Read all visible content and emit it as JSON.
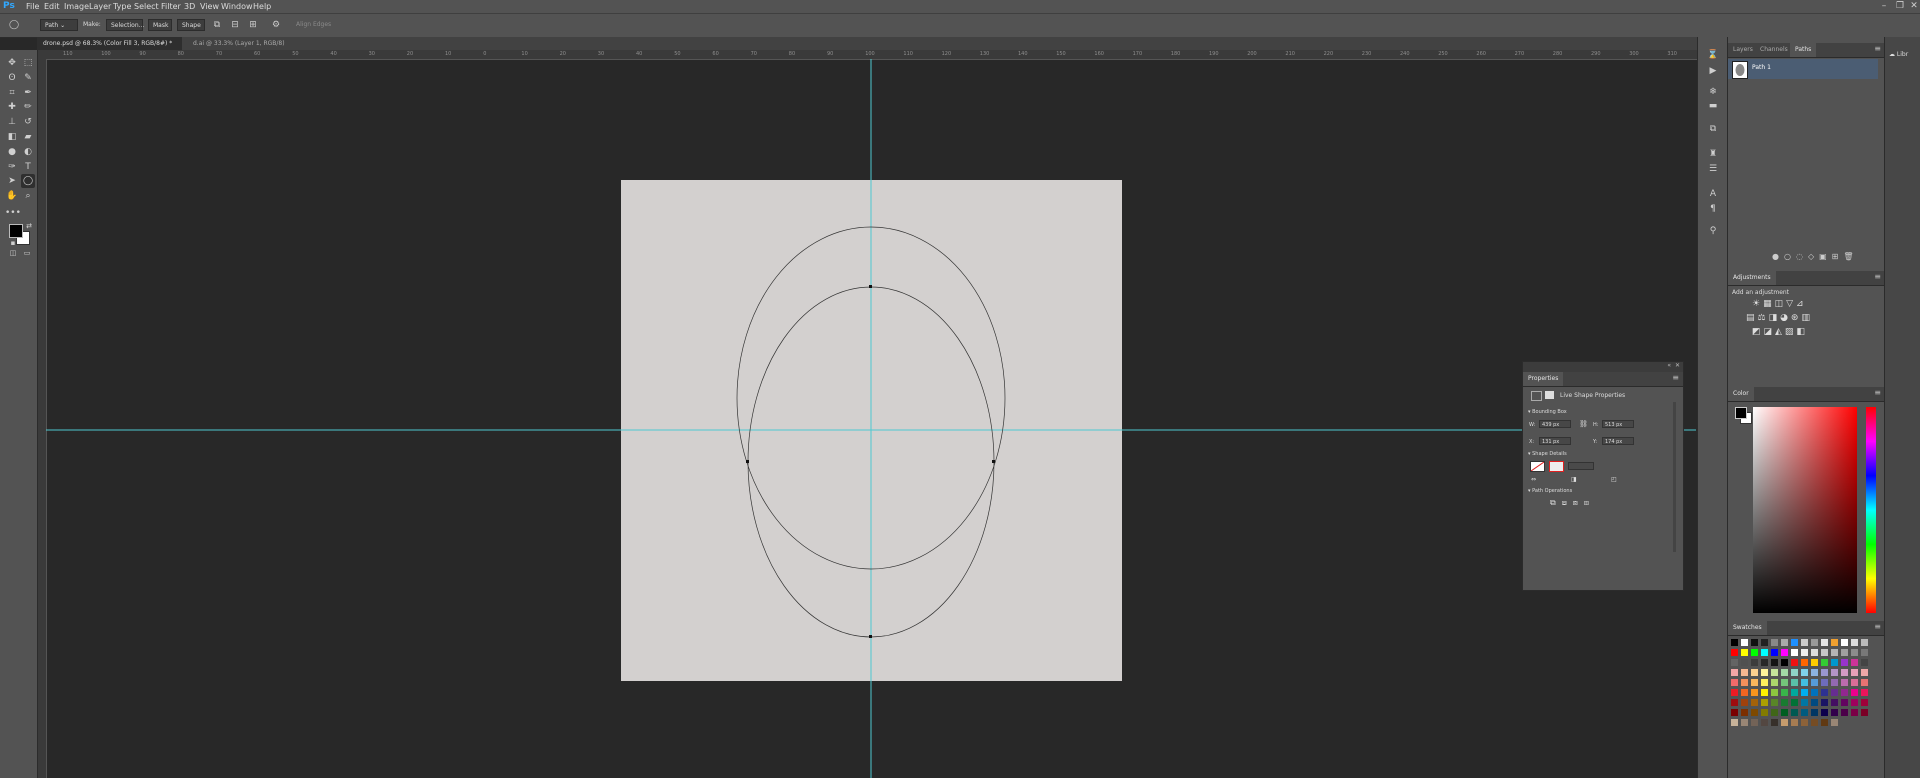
{
  "app": {
    "logo": "Ps",
    "accent": "#31a8ff"
  },
  "menu": {
    "items": [
      "File",
      "Edit",
      "Image",
      "Layer",
      "Type",
      "Select",
      "Filter",
      "3D",
      "View",
      "Window",
      "Help"
    ]
  },
  "window_controls": {
    "minimize": "–",
    "restore": "❐",
    "close": "✕"
  },
  "options_bar": {
    "mode_value": "Path",
    "make_label": "Make:",
    "selection_button": "Selection...",
    "mask_button": "Mask",
    "shape_button": "Shape",
    "align_edges_label": "Align Edges"
  },
  "tabs": [
    {
      "label": "drone.psd @ 68.3% (Color Fill 3, RGB/8#) *",
      "active": true
    },
    {
      "label": "d.ai @ 33.3% (Layer 1, RGB/8)",
      "active": false
    }
  ],
  "ruler_ticks": [
    "110",
    "100",
    "90",
    "80",
    "70",
    "60",
    "50",
    "40",
    "30",
    "20",
    "10",
    "0",
    "10",
    "20",
    "30",
    "40",
    "50",
    "60",
    "70",
    "80",
    "90",
    "100",
    "110",
    "120",
    "130",
    "140",
    "150",
    "160",
    "170",
    "180",
    "190",
    "200",
    "210",
    "220",
    "230",
    "240",
    "250",
    "260",
    "270",
    "280",
    "290",
    "300",
    "310"
  ],
  "toolbox": {
    "tools": [
      {
        "name": "move-tool-icon",
        "glyph": "✥"
      },
      {
        "name": "marquee-tool-icon",
        "glyph": "⬚"
      },
      {
        "name": "lasso-tool-icon",
        "glyph": "ʘ"
      },
      {
        "name": "quick-select-tool-icon",
        "glyph": "✎"
      },
      {
        "name": "crop-tool-icon",
        "glyph": "⌗"
      },
      {
        "name": "eyedropper-tool-icon",
        "glyph": "✒"
      },
      {
        "name": "healing-tool-icon",
        "glyph": "✚"
      },
      {
        "name": "brush-tool-icon",
        "glyph": "✏"
      },
      {
        "name": "stamp-tool-icon",
        "glyph": "⊥"
      },
      {
        "name": "history-brush-tool-icon",
        "glyph": "↺"
      },
      {
        "name": "eraser-tool-icon",
        "glyph": "◧"
      },
      {
        "name": "gradient-tool-icon",
        "glyph": "▰"
      },
      {
        "name": "blur-tool-icon",
        "glyph": "●"
      },
      {
        "name": "dodge-tool-icon",
        "glyph": "◐"
      },
      {
        "name": "pen-tool-icon",
        "glyph": "✑"
      },
      {
        "name": "type-tool-icon",
        "glyph": "T"
      },
      {
        "name": "path-select-tool-icon",
        "glyph": "➤"
      },
      {
        "name": "ellipse-tool-icon",
        "glyph": "◯"
      },
      {
        "name": "hand-tool-icon",
        "glyph": "✋"
      },
      {
        "name": "zoom-tool-icon",
        "glyph": "⌕"
      }
    ],
    "more": "•••",
    "foreground_color": "#000000",
    "background_color": "#ffffff"
  },
  "paths_panel": {
    "tabs": [
      "Layers",
      "Channels",
      "Paths"
    ],
    "selected_tab": "Paths",
    "path_name": "Path 1"
  },
  "adjustments_panel": {
    "title": "Adjustments",
    "subtitle": "Add an adjustment"
  },
  "color_panel": {
    "title": "Color"
  },
  "swatches_panel": {
    "title": "Swatches",
    "colors": [
      "#000000",
      "#ffffff",
      "#111111",
      "#222222",
      "#888888",
      "#aaaaaa",
      "#1e90ff",
      "#cccccc",
      "#999999",
      "#e6e6e6",
      "#f0a030",
      "#ffffff",
      "#dddddd",
      "#bbbbbb",
      "#ff0000",
      "#ffff00",
      "#00ff00",
      "#00ffff",
      "#0000ff",
      "#ff00ff",
      "#ffffff",
      "#eeeeee",
      "#dcdcdc",
      "#c8c8c8",
      "#b4b4b4",
      "#a0a0a0",
      "#8c8c8c",
      "#787878",
      "#646464",
      "#505050",
      "#3c3c3c",
      "#282828",
      "#141414",
      "#000000",
      "#ee1111",
      "#ff6600",
      "#ffcc00",
      "#33cc33",
      "#0099cc",
      "#9933cc",
      "#cc3399",
      "#444444",
      "#f4a6a6",
      "#f7b891",
      "#fbd08f",
      "#fff29a",
      "#c6e39b",
      "#a3d9a5",
      "#8fd4c6",
      "#7fd1e9",
      "#8cb3e1",
      "#9a97cf",
      "#b395c6",
      "#d29ac4",
      "#e8a0b8",
      "#f0a8a8",
      "#f06a6a",
      "#f58f5b",
      "#f9b65c",
      "#fff05c",
      "#acd66b",
      "#74c57a",
      "#59c0a8",
      "#42bfe0",
      "#569bd7",
      "#6e6cbb",
      "#9369b1",
      "#bb6bae",
      "#dc6d97",
      "#e87272",
      "#ed1c24",
      "#f26522",
      "#f7941d",
      "#fff200",
      "#8dc63f",
      "#39b54a",
      "#00a99d",
      "#00aeef",
      "#0072bc",
      "#2e3192",
      "#662d91",
      "#92278f",
      "#ec008c",
      "#ed145b",
      "#9e0b0f",
      "#a0410d",
      "#a36209",
      "#aba000",
      "#598527",
      "#197b30",
      "#007236",
      "#0076a3",
      "#004a80",
      "#1b1464",
      "#440e62",
      "#630460",
      "#9e005d",
      "#9e0039",
      "#790000",
      "#7b2e00",
      "#7d4900",
      "#827b00",
      "#406618",
      "#005e20",
      "#005952",
      "#005b7f",
      "#003663",
      "#0d004c",
      "#32004b",
      "#4b0049",
      "#7b0046",
      "#7a0026",
      "#c7b299",
      "#998675",
      "#736357",
      "#534741",
      "#37302a",
      "#c69c6d",
      "#a67c52",
      "#8c6239",
      "#754c24",
      "#603913",
      "#998675"
    ]
  },
  "properties_panel": {
    "title": "Properties",
    "subtitle": "Live Shape Properties",
    "bounding_box_label": "Bounding Box",
    "w_label": "W:",
    "w_value": "439 px",
    "h_label": "H:",
    "h_value": "513 px",
    "x_label": "X:",
    "x_value": "131 px",
    "y_label": "Y:",
    "y_value": "174 px",
    "shape_details_label": "Shape Details",
    "path_operations_label": "Path Operations"
  },
  "right_strip_label": "Libr"
}
